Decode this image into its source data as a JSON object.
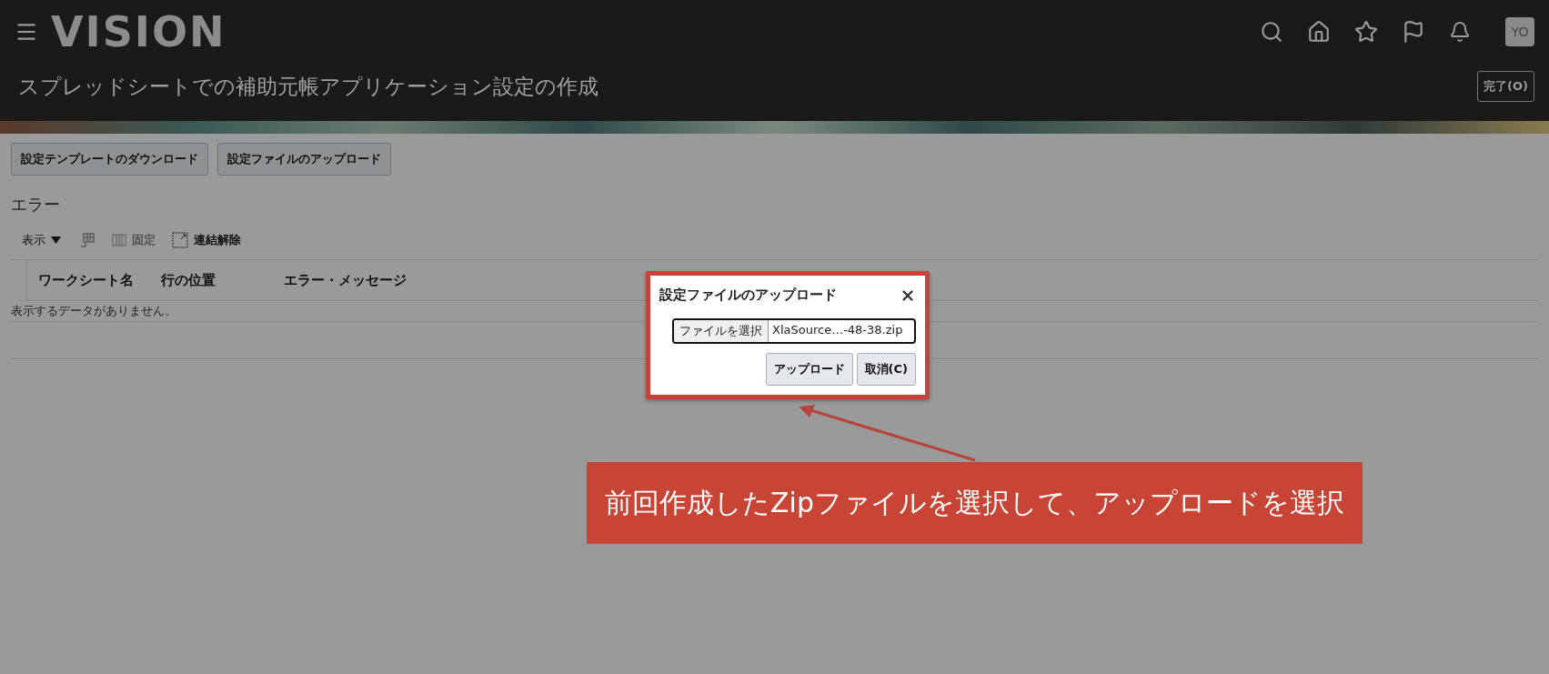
{
  "header": {
    "logo": "VISION",
    "avatar": "YO",
    "page_title": "スプレッドシートでの補助元帳アプリケーション設定の作成",
    "done_button": "完了(O)"
  },
  "actions": [
    "設定テンプレートのダウンロード",
    "設定ファイルのアップロード"
  ],
  "errors": {
    "title": "エラー",
    "toolbar": [
      {
        "kind": "menu",
        "label": "表示",
        "disabled": false
      },
      {
        "kind": "icon",
        "disabled": true
      },
      {
        "kind": "freeze",
        "label": "固定",
        "disabled": true
      },
      {
        "kind": "detach",
        "label": "連結解除",
        "disabled": false
      }
    ],
    "columns": [
      "ワークシート名",
      "行の位置",
      "エラー・メッセージ"
    ],
    "empty_message": "表示するデータがありません。"
  },
  "dialog": {
    "title": "設定ファイルのアップロード",
    "choose_button": "ファイルを選択",
    "file_name": "XlaSource…-48-38.zip",
    "buttons": [
      "アップロード",
      "取消(C)"
    ]
  },
  "callout": "前回作成したZipファイルを選択して、アップロードを選択"
}
